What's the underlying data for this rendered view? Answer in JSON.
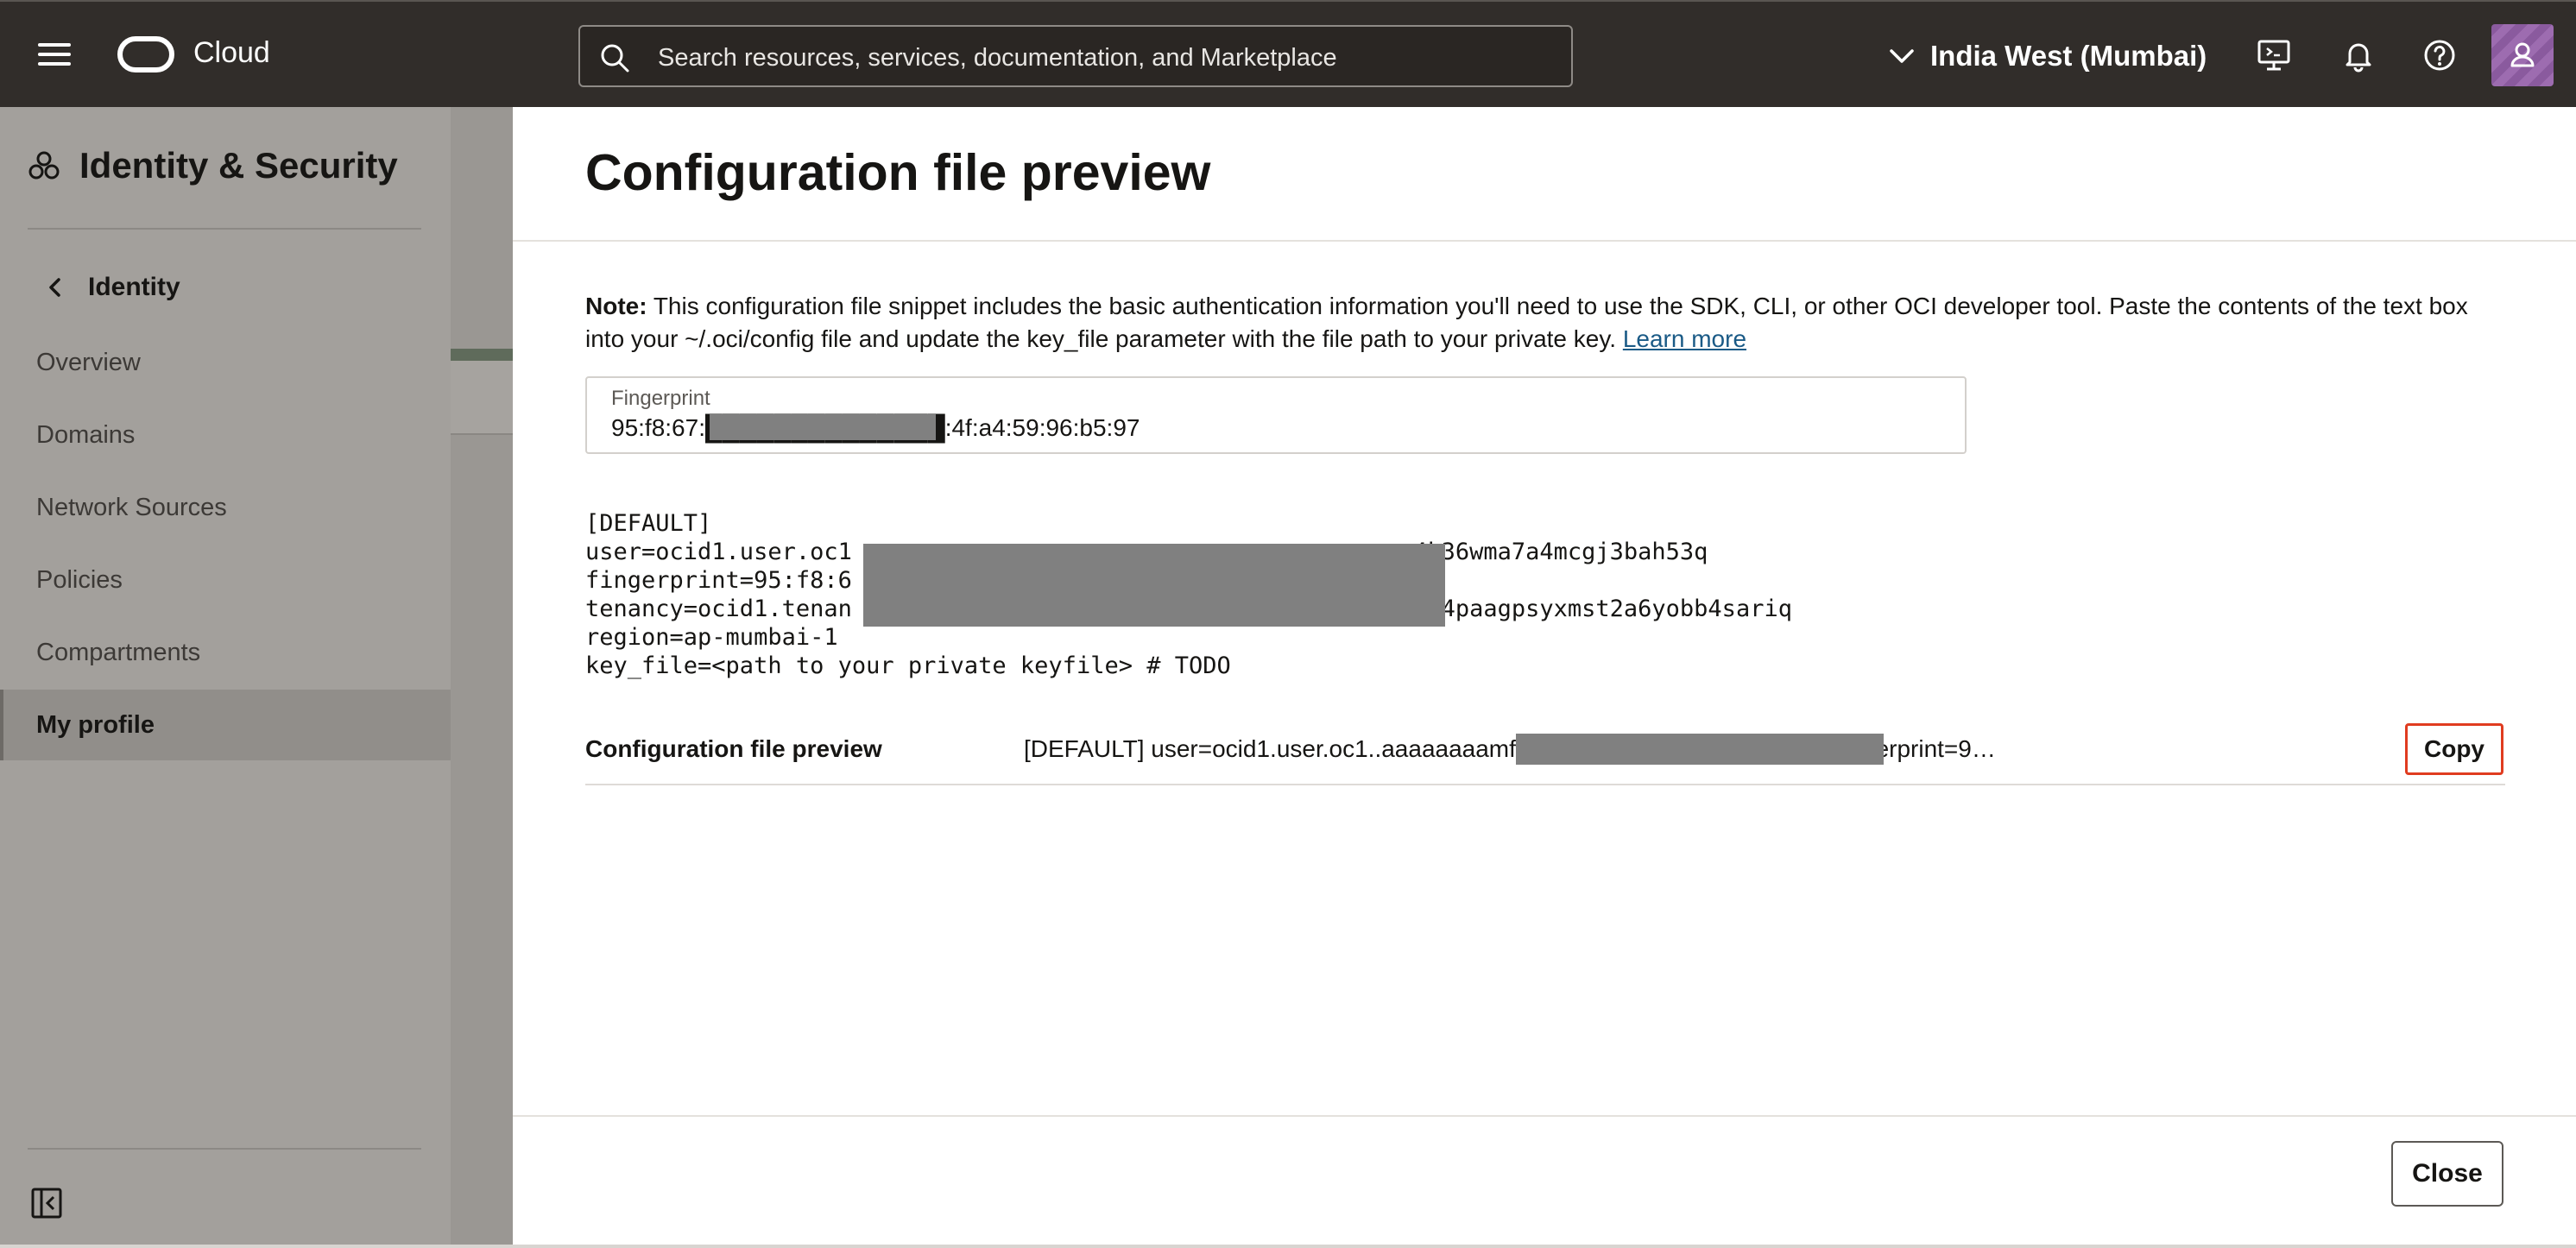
{
  "header": {
    "brand": "Cloud",
    "search_placeholder": "Search resources, services, documentation, and Marketplace",
    "region": "India West (Mumbai)",
    "icons": [
      "menu-icon",
      "oracle-logo",
      "search-icon",
      "chevron-down-icon",
      "cloud-shell-icon",
      "bell-icon",
      "help-icon",
      "user-avatar"
    ]
  },
  "sidebar": {
    "title": "Identity & Security",
    "back_label": "Identity",
    "items": [
      {
        "label": "Overview"
      },
      {
        "label": "Domains"
      },
      {
        "label": "Network Sources"
      },
      {
        "label": "Policies"
      },
      {
        "label": "Compartments"
      },
      {
        "label": "My profile",
        "active": true
      }
    ]
  },
  "panel": {
    "title": "Configuration file preview",
    "note_bold": "Note:",
    "note_text": " This configuration file snippet includes the basic authentication information you'll need to use the SDK, CLI, or other OCI developer tool. Paste the contents of the text box into your ~/.oci/config file and update the key_file parameter with the file path to your private key. ",
    "note_link": "Learn more",
    "fingerprint_label": "Fingerprint",
    "fingerprint_value": "95:f8:67:██████████████:4f:a4:59:96:b5:97",
    "config_lines": [
      "[DEFAULT]",
      "user=ocid1.user.oc1                                       m4k36wma7a4mcgj3bah53q",
      "fingerprint=95:f8:6",
      "tenancy=ocid1.tenan                                       kwm4paagpsyxmst2a6yobb4sariq",
      "region=ap-mumbai-1",
      "key_file=<path to your private keyfile> # TODO"
    ],
    "preview_label": "Configuration file preview",
    "preview_value": "[DEFAULT] user=ocid1.user.oc1..aaaaaaaamffz                                    4k36wma7a4mcgj3bah53q fingerprint=9…",
    "copy_label": "Copy",
    "close_label": "Close"
  },
  "colors": {
    "header_bg": "#312d2a",
    "sidebar_bg": "#a3a09c",
    "redaction": "#808080",
    "copy_highlight": "#e03c20",
    "link": "#1a5a86"
  }
}
